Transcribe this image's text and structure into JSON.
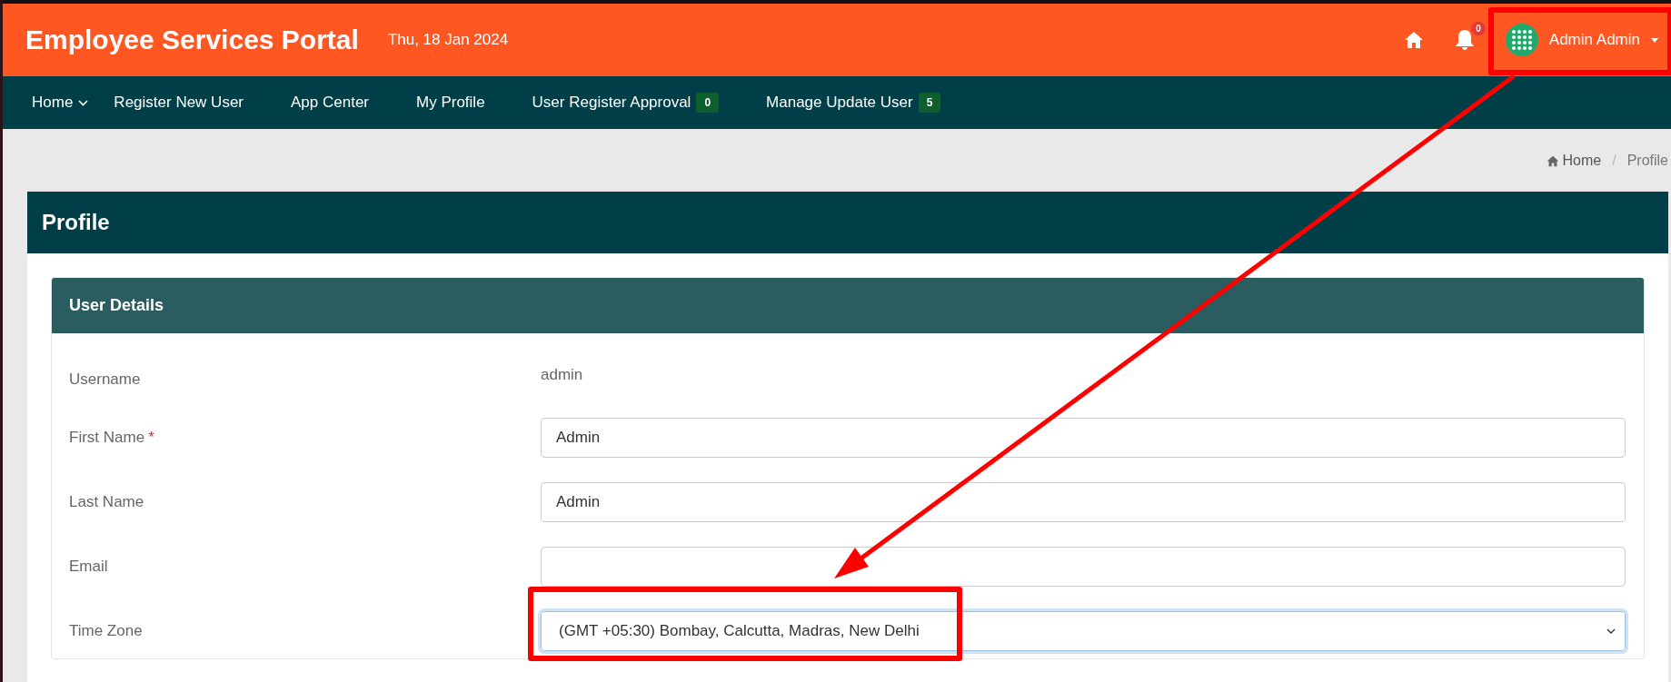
{
  "header": {
    "title": "Employee Services Portal",
    "date": "Thu, 18 Jan 2024",
    "notification_count": "0",
    "user_name": "Admin Admin"
  },
  "nav": [
    {
      "label": "Home",
      "kind": "dropdown"
    },
    {
      "label": "Register New User",
      "kind": "link"
    },
    {
      "label": "App Center",
      "kind": "link"
    },
    {
      "label": "My Profile",
      "kind": "link"
    },
    {
      "label": "User Register Approval",
      "kind": "link",
      "badge": "0"
    },
    {
      "label": "Manage Update User",
      "kind": "link",
      "badge": "5"
    }
  ],
  "breadcrumb": [
    {
      "label": "Home",
      "kind": "link"
    },
    {
      "label": "Profile",
      "kind": "current"
    }
  ],
  "breadcrumb_separator": "/",
  "profile": {
    "title": "Profile",
    "section_title": "User Details",
    "required_mark": "*",
    "fields": [
      {
        "label": "Username",
        "kind": "static",
        "value": "admin",
        "required": false
      },
      {
        "label": "First Name",
        "kind": "text",
        "value": "Admin",
        "required": true
      },
      {
        "label": "Last Name",
        "kind": "text",
        "value": "Admin",
        "required": false
      },
      {
        "label": "Email",
        "kind": "text",
        "required": false
      },
      {
        "label": "Time Zone",
        "kind": "select",
        "value": "(GMT +05:30) Bombay, Calcutta, Madras, New Delhi",
        "required": false
      }
    ]
  }
}
